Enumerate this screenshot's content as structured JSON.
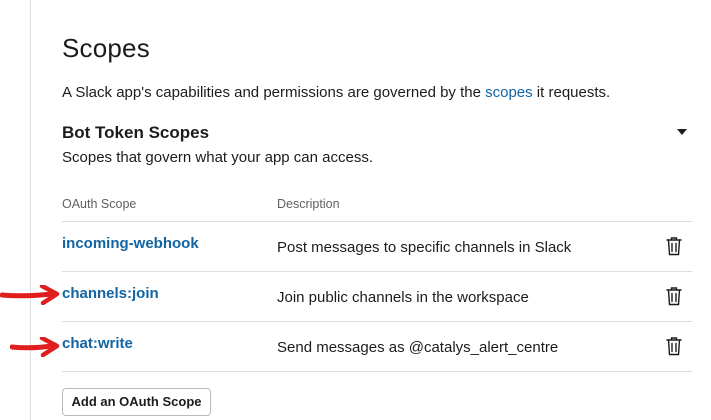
{
  "page": {
    "title": "Scopes",
    "intro_before_link": "A Slack app's capabilities and permissions are governed by the ",
    "intro_link": "scopes",
    "intro_after_link": " it requests."
  },
  "bot_section": {
    "title": "Bot Token Scopes",
    "subtitle": "Scopes that govern what your app can access.",
    "columns": {
      "scope": "OAuth Scope",
      "description": "Description"
    },
    "rows": [
      {
        "scope": "incoming-webhook",
        "description": "Post messages to specific channels in Slack"
      },
      {
        "scope": "channels:join",
        "description": "Join public channels in the workspace"
      },
      {
        "scope": "chat:write",
        "description": "Send messages as @catalys_alert_centre"
      }
    ],
    "add_button": "Add an OAuth Scope"
  },
  "colors": {
    "link": "#1264a3",
    "annotation_arrow": "#e01e1e",
    "text": "#1d1c1d",
    "muted": "#616061"
  },
  "icons": {
    "row_action": "trash-icon",
    "collapse": "caret-down-icon",
    "annotation": "red-arrow-annotation"
  }
}
